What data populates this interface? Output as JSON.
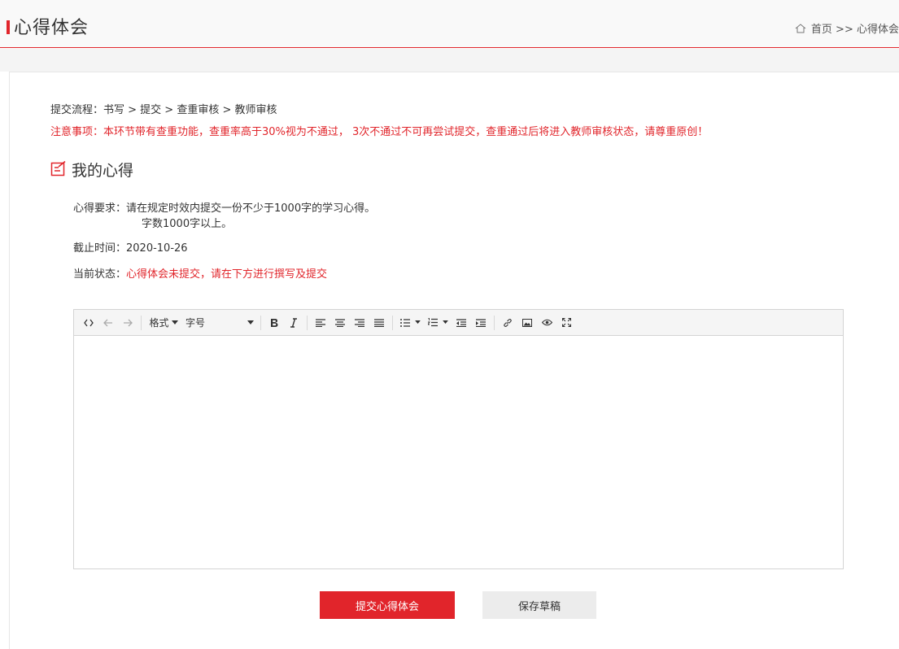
{
  "header": {
    "title": "心得体会",
    "breadcrumb": {
      "home": "首页",
      "separator": " >> ",
      "current": "心得体会"
    }
  },
  "process": {
    "label": "提交流程：",
    "steps": "书写 > 提交 > 查重审核 > 教师审核"
  },
  "notice": "注意事项：本环节带有查重功能，查重率高于30%视为不通过， 3次不通过不可再尝试提交，查重通过后将进入教师审核状态，请尊重原创！",
  "section": {
    "title": "我的心得"
  },
  "info": {
    "requirement_label": "心得要求：",
    "requirement_text": "请在规定时效内提交一份不少于1000字的学习心得。",
    "requirement_text2": "字数1000字以上。",
    "deadline_label": "截止时间：",
    "deadline_value": "2020-10-26",
    "status_label": "当前状态：",
    "status_value": "心得体会未提交，请在下方进行撰写及提交"
  },
  "toolbar": {
    "format_label": "格式",
    "fontsize_label": "字号",
    "icons": [
      "code-icon",
      "undo-icon",
      "redo-icon",
      "bold-icon",
      "italic-icon",
      "align-left-icon",
      "align-center-icon",
      "align-right-icon",
      "align-justify-icon",
      "bullet-list-icon",
      "numbered-list-icon",
      "outdent-icon",
      "indent-icon",
      "link-icon",
      "image-icon",
      "preview-icon",
      "fullscreen-icon"
    ]
  },
  "buttons": {
    "submit": "提交心得体会",
    "save_draft": "保存草稿"
  },
  "colors": {
    "accent": "#e1252b",
    "draft_button": "#ececec",
    "toolbar_bg": "#f5f5f5"
  }
}
